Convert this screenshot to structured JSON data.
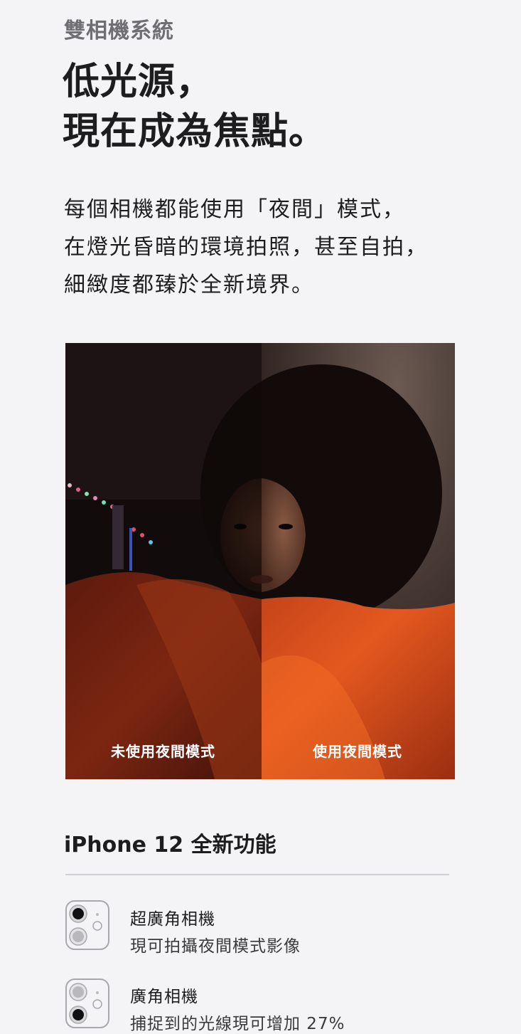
{
  "section": {
    "eyebrow": "雙相機系統",
    "headline_lines": [
      "低光源，",
      "現在成為焦點。"
    ],
    "body_lines": [
      "每個相機都能使用「夜間」模式，",
      "在燈光昏暗的環境拍照，甚至自拍，",
      "細緻度都臻於全新境界。"
    ]
  },
  "photo": {
    "left_label": "未使用夜間模式",
    "right_label": "使用夜間模式"
  },
  "features": {
    "title": "iPhone 12 全新功能",
    "items": [
      {
        "icon": "ultra-wide-camera-icon",
        "title": "超廣角相機",
        "desc": "現可拍攝夜間模式影像"
      },
      {
        "icon": "wide-camera-icon",
        "title": "廣角相機",
        "desc": "捕捉到的光線現可增加 27%"
      }
    ]
  },
  "colors": {
    "background": "#f4f4f6",
    "text": "#1d1d1f",
    "eyebrow": "#6e6e73"
  }
}
